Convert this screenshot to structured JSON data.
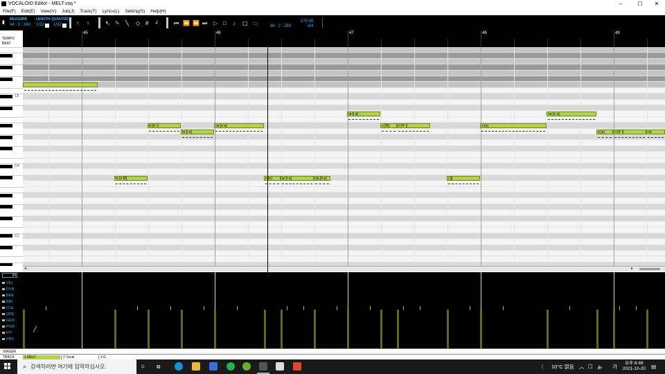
{
  "window": {
    "title": "VOCALOID Editor - MELT.vsq *",
    "minimize": "–",
    "maximize": "☐",
    "close": "✕"
  },
  "menu": [
    "File(F)",
    "Edit(E)",
    "View(V)",
    "Job(J)",
    "Track(T)",
    "Lyrics(L)",
    "Setting(S)",
    "Help(H)"
  ],
  "toolbar": {
    "measure_label": "MEASURE",
    "length_label": "LENGTH",
    "quantize_label": "QUANTIZE",
    "measure_value": "44 : 3 : 240",
    "length_value": "1/32",
    "quantize_value": "1/32",
    "position_value": "46 : 2 : 280",
    "tempo_value": "170.00",
    "beat_value": "4/4",
    "accent_color": "#3fb8ff"
  },
  "ruler": {
    "tempo_label": "TEMPO",
    "beat_label": "BEAT",
    "measures": [
      "45",
      "46",
      "47",
      "48",
      "49"
    ]
  },
  "piano": {
    "octave_labels": [
      "C5",
      "C4",
      "C3"
    ]
  },
  "notes": [
    {
      "lyric": "",
      "row": 6,
      "start": 0,
      "len": 108
    },
    {
      "lyric": "ts [s M]",
      "row": 22,
      "start": 132,
      "len": 48
    },
    {
      "lyric": "ki [k' i]",
      "row": 13,
      "start": 180,
      "len": 48
    },
    {
      "lyric": "ta [t a]",
      "row": 14,
      "start": 228,
      "len": 48
    },
    {
      "lyric": "na [n a]",
      "row": 13,
      "start": 276,
      "len": 72
    },
    {
      "lyric": "n [n]",
      "row": 22,
      "start": 348,
      "len": 24
    },
    {
      "lyric": "te [t e]",
      "row": 22,
      "start": 372,
      "len": 48
    },
    {
      "lyric": "da [d a]",
      "row": 22,
      "start": 420,
      "len": 24
    },
    {
      "lyric": "ta [t a]",
      "row": 11,
      "start": 468,
      "len": 48
    },
    {
      "lyric": "u [M]",
      "row": 13,
      "start": 516,
      "len": 24
    },
    {
      "lyric": "ri [4' i]",
      "row": 13,
      "start": 540,
      "len": 48
    },
    {
      "lyric": "i [i]",
      "row": 22,
      "start": 612,
      "len": 48
    },
    {
      "lyric": "a [a]",
      "row": 13,
      "start": 660,
      "len": 96
    },
    {
      "lyric": "na [n a]",
      "row": 11,
      "start": 756,
      "len": 72
    },
    {
      "lyric": "a [a]",
      "row": 14,
      "start": 828,
      "len": 24
    },
    {
      "lyric": "ri [4' i]",
      "row": 14,
      "start": 852,
      "len": 48
    },
    {
      "lyric": "na",
      "row": 14,
      "start": 900,
      "len": 27
    }
  ],
  "control": {
    "value": "24",
    "items": [
      "VEL",
      "DYN",
      "BRE",
      "BRI",
      "CLE",
      "OPE",
      "GEN",
      "POR",
      "PIT",
      "PBS"
    ],
    "selected": "VEL"
  },
  "singer_label": "SINGER",
  "track_label": "TRACK",
  "tracks": [
    "1 MELT",
    "2 Vocal",
    "3 G"
  ],
  "taskbar": {
    "search_placeholder": "검색하려면 여기에 입력하십시오.",
    "weather": "10°C 맑음",
    "ime": "가",
    "time": "오후 8:48",
    "date": "2021-10-20"
  }
}
